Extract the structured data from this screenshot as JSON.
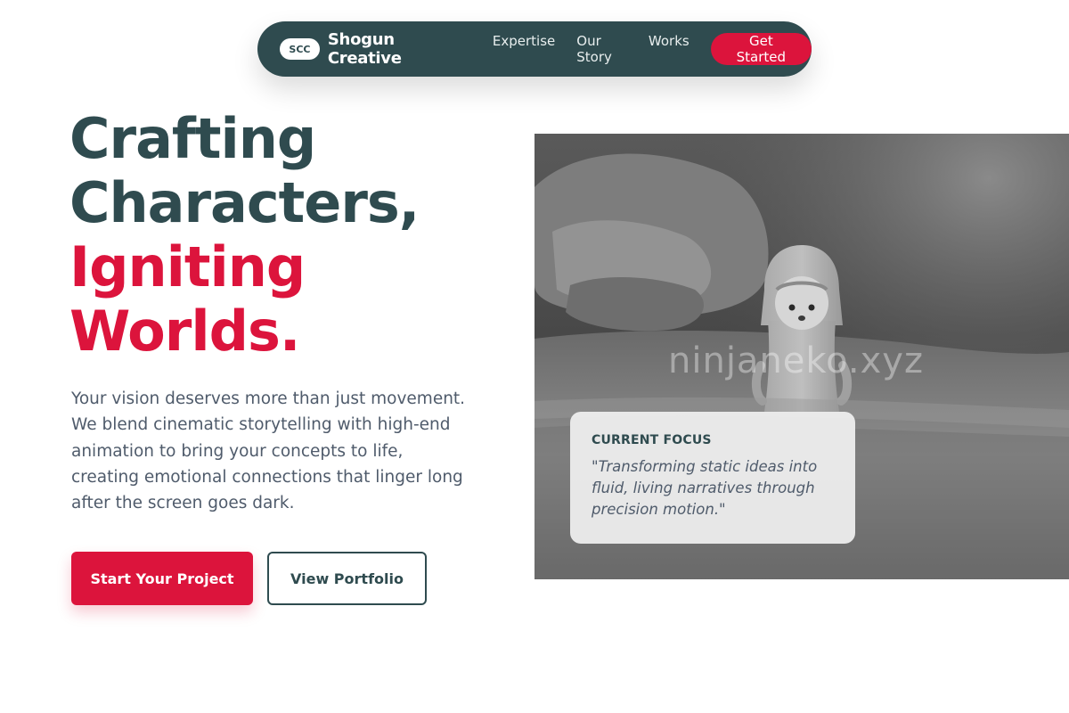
{
  "nav": {
    "logo_badge": "SCC",
    "brand": "Shogun Creative",
    "links": [
      "Expertise",
      "Our Story",
      "Works"
    ],
    "cta": "Get Started"
  },
  "hero": {
    "headline": [
      "Crafting",
      "Characters,",
      "Igniting",
      "Worlds."
    ],
    "description": "Your vision deserves more than just movement. We blend cinematic storytelling with high-end animation to bring your concepts to life, creating emotional connections that linger long after the screen goes dark.",
    "primary_button": "Start Your Project",
    "secondary_button": "View Portfolio"
  },
  "image": {
    "watermark": "ninjaneko.xyz",
    "focus_card": {
      "label": "CURRENT FOCUS",
      "quote": "\"Transforming static ideas into fluid, living narratives through precision motion.\""
    }
  },
  "colors": {
    "primary_dark": "#2f4b4f",
    "accent": "#dc143c",
    "text_muted": "#4f5b6b"
  }
}
